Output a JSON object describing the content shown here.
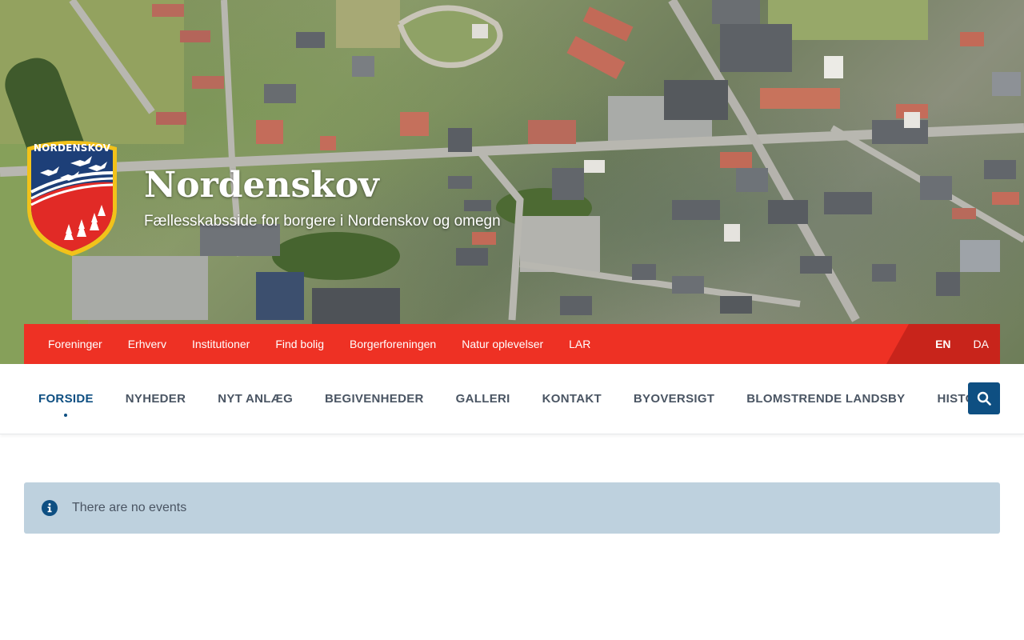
{
  "site": {
    "logo_text": "NORDENSKOV",
    "title": "Nordenskov",
    "tagline": "Fællesskabsside for borgere i Nordenskov og omegn"
  },
  "topbar": {
    "links": [
      "Foreninger",
      "Erhverv",
      "Institutioner",
      "Find bolig",
      "Borgerforeningen",
      "Natur oplevelser",
      "LAR"
    ],
    "languages": [
      {
        "label": "EN",
        "active": true
      },
      {
        "label": "DA",
        "active": false
      }
    ]
  },
  "mainnav": {
    "items": [
      "FORSIDE",
      "NYHEDER",
      "NYT ANLÆG",
      "BEGIVENHEDER",
      "GALLERI",
      "KONTAKT",
      "BYOVERSIGT",
      "BLOMSTRENDE LANDSBY",
      "HISTORIE"
    ],
    "active_index": 0,
    "search_icon": "search-icon"
  },
  "notice": {
    "icon": "info-icon",
    "text": "There are no events"
  },
  "colors": {
    "topbar": "#ee3124",
    "topbar_lang": "#c8241b",
    "accent": "#0e4f82",
    "notice_bg": "#bed1de",
    "text": "#4a5563"
  }
}
